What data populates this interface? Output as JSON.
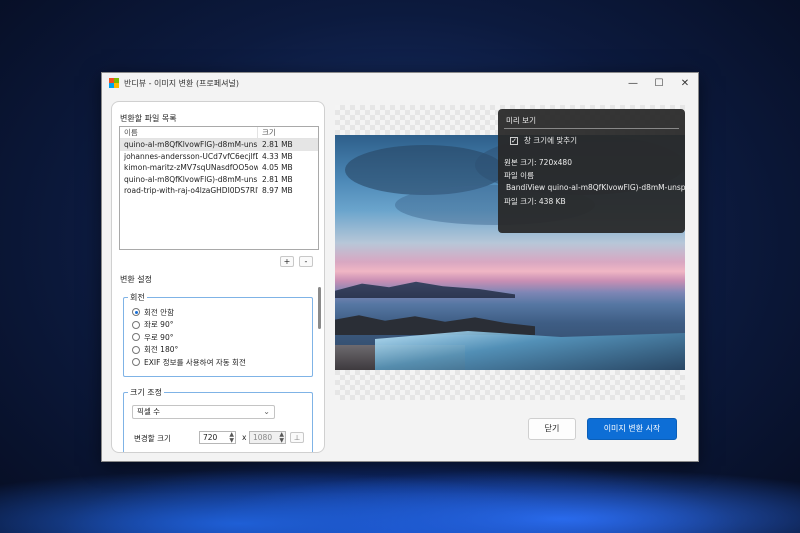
{
  "window": {
    "title": "반디뷰 - 이미지 변환 (프로페셔널)",
    "controls": {
      "minimize": "—",
      "maximize": "☐",
      "close": "✕"
    }
  },
  "file_list": {
    "title": "변환할 파일 목록",
    "columns": [
      "이름",
      "크기"
    ],
    "rows": [
      {
        "name": "quino-al-m8QfKlvowFlG)-d8mM-uns…",
        "size": "2.81 MB"
      },
      {
        "name": "johannes-andersson-UCd7vfC6ecjlfD…",
        "size": "4.33 MB"
      },
      {
        "name": "kimon-maritz-zMV7sqUNasdfOO5ow-…",
        "size": "4.05 MB"
      },
      {
        "name": "quino-al-m8QfKlvowFlG)-d8mM-uns…",
        "size": "2.81 MB"
      },
      {
        "name": "road-trip-with-raj-o4lzaGHDI0DS7RIW…",
        "size": "8.97 MB"
      }
    ],
    "add_label": "+",
    "remove_label": "-"
  },
  "settings": {
    "title": "변환 설정",
    "rotation": {
      "label": "회전",
      "options": [
        "회전 안함",
        "좌로 90°",
        "우로 90°",
        "회전 180°",
        "EXIF 정보를 사용하여 자동 회전"
      ],
      "selected_index": 0
    },
    "resize": {
      "label": "크기 조정",
      "select_value": "픽셀 수",
      "size_label": "변경할 크기",
      "width": "720",
      "x_label": "x",
      "height": "1080",
      "lock_label": "⟂"
    }
  },
  "preview_info": {
    "title": "미리 보기",
    "fit_label": "창 크기에 맞추기",
    "fit_checked": "✓",
    "image_size": "원본 크기: 720x480",
    "file_name_label": "파일 이름",
    "file_name": "BandiView quino-al-m8QfKlvowFlG)-d8mM-unsp…",
    "file_size": "파일 크기: 438 KB"
  },
  "buttons": {
    "close": "닫기",
    "start": "이미지 변환 시작"
  },
  "colors": {
    "accent": "#0d6ed6",
    "group_border": "#7fb3e6",
    "app_icon": [
      "#f25022",
      "#7fba00",
      "#00a4ef",
      "#ffb900"
    ]
  }
}
